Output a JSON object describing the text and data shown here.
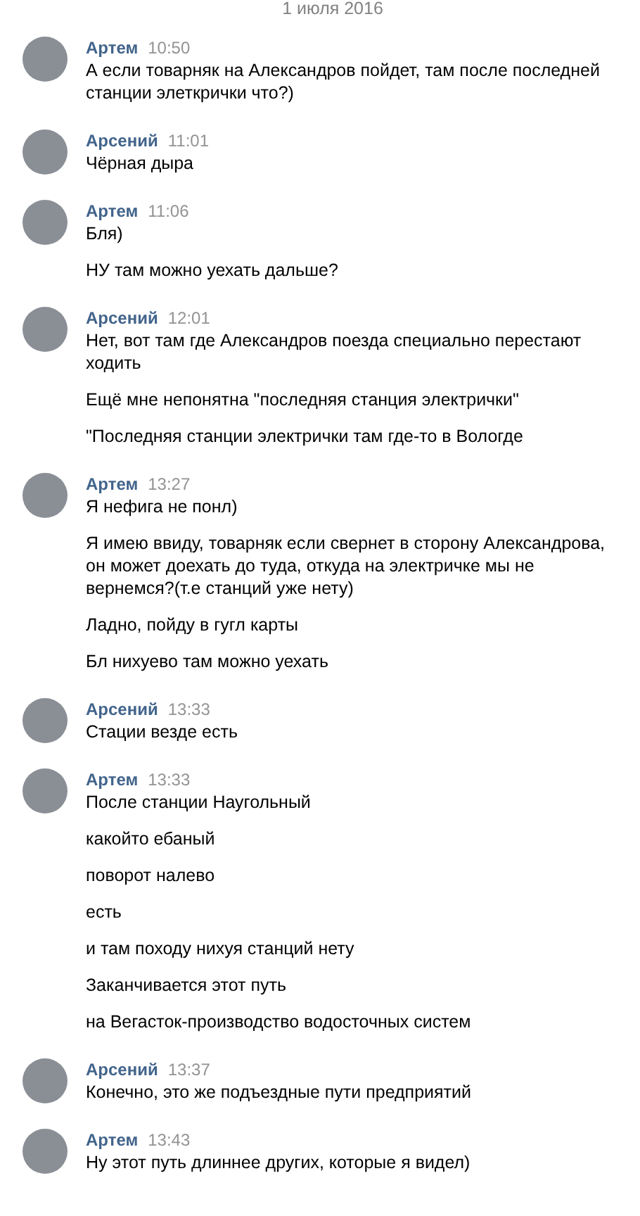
{
  "date": "1 июля 2016",
  "groups": [
    {
      "author": "Артем",
      "time": "10:50",
      "messages": [
        "А если товарняк на Александров пойдет, там после последней станции элеткрички что?)"
      ]
    },
    {
      "author": "Арсений",
      "time": "11:01",
      "messages": [
        "Чёрная дыра"
      ]
    },
    {
      "author": "Артем",
      "time": "11:06",
      "messages": [
        "Бля)",
        "НУ там можно уехать дальше?"
      ]
    },
    {
      "author": "Арсений",
      "time": "12:01",
      "messages": [
        "Нет, вот там где Александров поезда специально перестают ходить",
        "Ещё мне непонятна \"последняя станция электрички\"",
        "\"Последняя станции электрички там где-то в Вологде"
      ]
    },
    {
      "author": "Артем",
      "time": "13:27",
      "messages": [
        "Я нефига не понл)",
        "Я имею ввиду, товарняк если свернет в сторону Александрова, он может доехать до туда, откуда на электричке мы не вернемся?(т.е станций уже нету)",
        "Ладно, пойду в гугл карты",
        "Бл нихуево там можно уехать"
      ]
    },
    {
      "author": "Арсений",
      "time": "13:33",
      "messages": [
        "Стации везде есть"
      ]
    },
    {
      "author": "Артем",
      "time": "13:33",
      "messages": [
        "После станции Наугольный",
        "какойто ебаный",
        "поворот налево",
        "есть",
        "и там походу нихуя станций нету",
        "Заканчивается этот путь",
        "на Вегасток-производство водосточных систем"
      ]
    },
    {
      "author": "Арсений",
      "time": "13:37",
      "messages": [
        "Конечно, это же подъездные пути предприятий"
      ]
    },
    {
      "author": "Артем",
      "time": "13:43",
      "messages": [
        "Ну этот путь длиннее других, которые я видел)"
      ]
    }
  ]
}
